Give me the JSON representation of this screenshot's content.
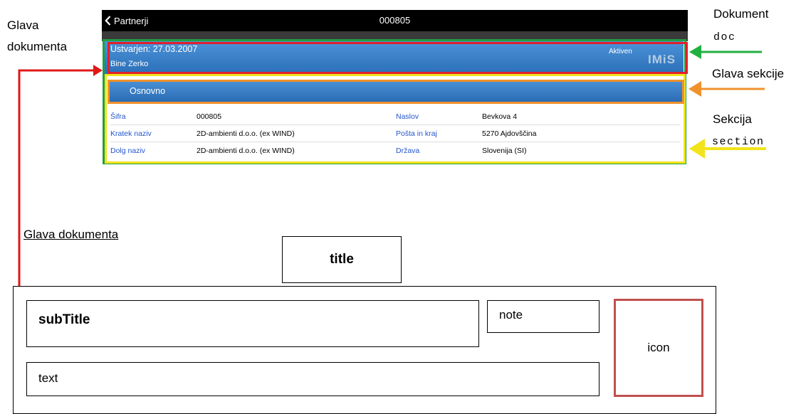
{
  "nav": {
    "back_label": "Partnerji",
    "title": "000805"
  },
  "doc_header": {
    "created": "Ustvarjen: 27.03.2007",
    "person": "Bine Zerko",
    "status": "Aktiven",
    "brand": "IMiS"
  },
  "section": {
    "label": "Osnovno",
    "rows": [
      {
        "label1": "Šifra",
        "value1": "000805",
        "label2": "Naslov",
        "value2": "Bevkova 4"
      },
      {
        "label1": "Kratek naziv",
        "value1": "2D-ambienti d.o.o. (ex WIND)",
        "label2": "Pošta in kraj",
        "value2": "5270 Ajdovščina"
      },
      {
        "label1": "Dolg naziv",
        "value1": "2D-ambienti d.o.o. (ex WIND)",
        "label2": "Država",
        "value2": "Slovenija (SI)"
      }
    ]
  },
  "annotations": {
    "glava_dokumenta_line1": "Glava",
    "glava_dokumenta_line2": "dokumenta",
    "dokument": "Dokument",
    "doc_code": "doc",
    "glava_sekcije": "Glava sekcije",
    "sekcija": "Sekcija",
    "section_code": "section",
    "schema_heading": "Glava dokumenta"
  },
  "schema": {
    "title": "title",
    "subtitle": "subTitle",
    "note": "note",
    "text": "text",
    "icon": "icon"
  },
  "colors": {
    "doc_border": "#20a040",
    "header_border": "#e0202a",
    "section_border": "#f2e31a",
    "section_head_border": "#f0922b",
    "header_blue": "#2a6fb8",
    "icon_box_border": "#c0504d"
  }
}
